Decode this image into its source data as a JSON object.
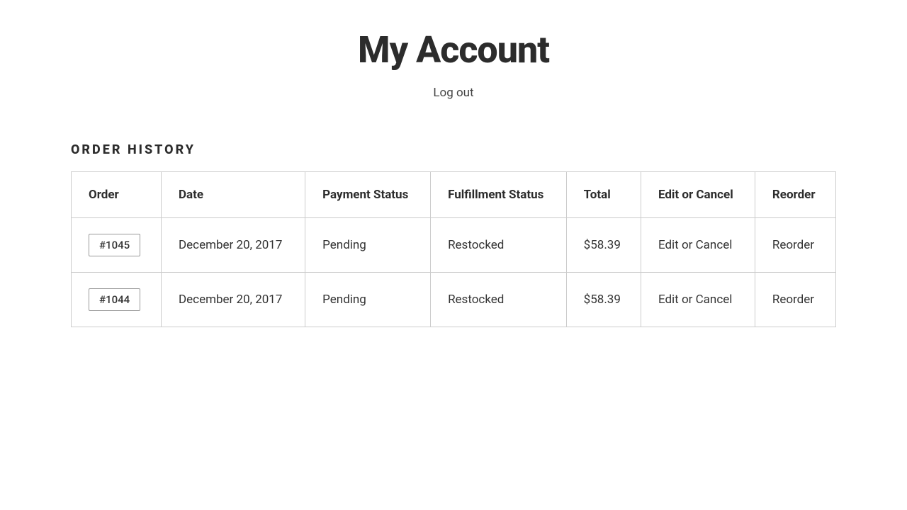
{
  "header": {
    "title": "My Account",
    "logout_label": "Log out"
  },
  "order_history": {
    "section_title": "ORDER HISTORY",
    "columns": [
      {
        "key": "order",
        "label": "Order"
      },
      {
        "key": "date",
        "label": "Date"
      },
      {
        "key": "payment_status",
        "label": "Payment Status"
      },
      {
        "key": "fulfillment_status",
        "label": "Fulfillment Status"
      },
      {
        "key": "total",
        "label": "Total"
      },
      {
        "key": "edit_or_cancel",
        "label": "Edit or Cancel"
      },
      {
        "key": "reorder",
        "label": "Reorder"
      }
    ],
    "rows": [
      {
        "order": "#1045",
        "date": "December 20, 2017",
        "payment_status": "Pending",
        "fulfillment_status": "Restocked",
        "total": "$58.39",
        "edit_or_cancel": "Edit or Cancel",
        "reorder": "Reorder"
      },
      {
        "order": "#1044",
        "date": "December 20, 2017",
        "payment_status": "Pending",
        "fulfillment_status": "Restocked",
        "total": "$58.39",
        "edit_or_cancel": "Edit or Cancel",
        "reorder": "Reorder"
      }
    ]
  }
}
